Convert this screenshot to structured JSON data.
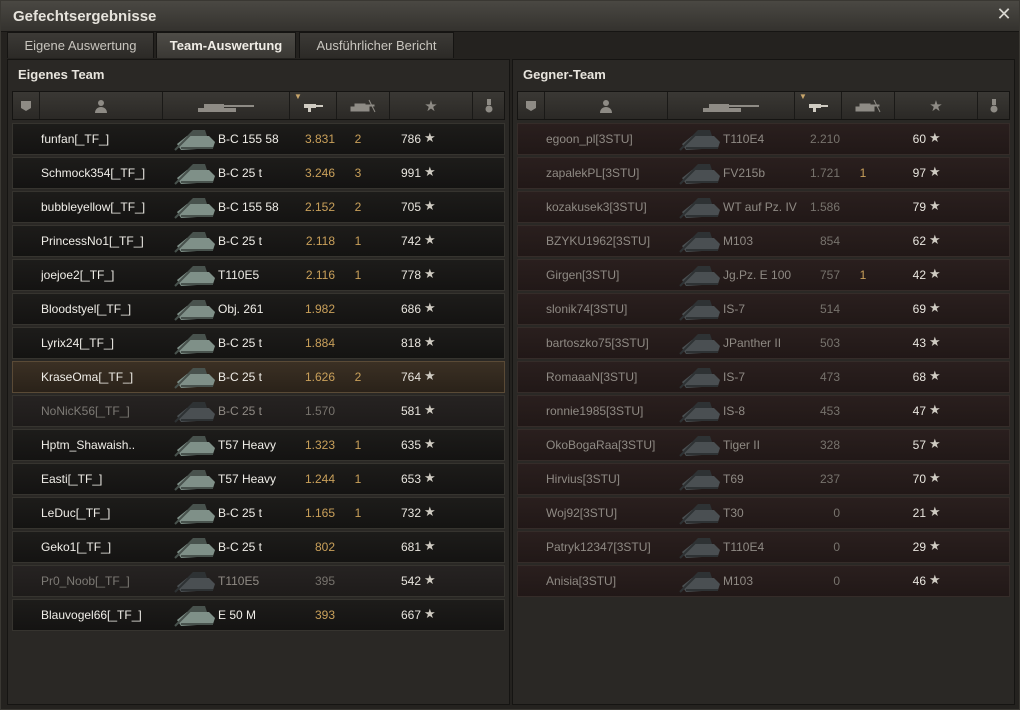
{
  "window": {
    "title": "Gefechtsergebnisse"
  },
  "tabs": [
    {
      "label": "Eigene Auswertung"
    },
    {
      "label": "Team-Auswertung"
    },
    {
      "label": "Ausführlicher Bericht"
    }
  ],
  "icons": {
    "close": "✕",
    "rank": "rank-icon",
    "player": "player-icon",
    "tank": "tank-icon",
    "damage": "damage-icon",
    "frags": "frags-icon",
    "star": "★",
    "medal": "medal-icon"
  },
  "colors": {
    "accent": "#c9a05a",
    "highlight_row": "#3b3024"
  },
  "own_team": {
    "title": "Eigenes Team",
    "rows": [
      {
        "name": "funfan[_TF_]",
        "tank": "B-C 155 58",
        "damage": "3.831",
        "kills": "2",
        "xp": "786",
        "state": "normal"
      },
      {
        "name": "Schmock354[_TF_]",
        "tank": "B-C 25 t",
        "damage": "3.246",
        "kills": "3",
        "xp": "991",
        "state": "normal"
      },
      {
        "name": "bubbleyellow[_TF_]",
        "tank": "B-C 155 58",
        "damage": "2.152",
        "kills": "2",
        "xp": "705",
        "state": "normal"
      },
      {
        "name": "PrincessNo1[_TF_]",
        "tank": "B-C 25 t",
        "damage": "2.118",
        "kills": "1",
        "xp": "742",
        "state": "normal"
      },
      {
        "name": "joejoe2[_TF_]",
        "tank": "T110E5",
        "damage": "2.116",
        "kills": "1",
        "xp": "778",
        "state": "normal"
      },
      {
        "name": "Bloodstyel[_TF_]",
        "tank": "Obj. 261",
        "damage": "1.982",
        "kills": "",
        "xp": "686",
        "state": "normal"
      },
      {
        "name": "Lyrix24[_TF_]",
        "tank": "B-C 25 t",
        "damage": "1.884",
        "kills": "",
        "xp": "818",
        "state": "normal"
      },
      {
        "name": "KraseOma[_TF_]",
        "tank": "B-C 25 t",
        "damage": "1.626",
        "kills": "2",
        "xp": "764",
        "state": "highlight"
      },
      {
        "name": "NoNicK56[_TF_]",
        "tank": "B-C 25 t",
        "damage": "1.570",
        "kills": "",
        "xp": "581",
        "state": "dead"
      },
      {
        "name": "Hptm_Shawaish..",
        "tank": "T57 Heavy",
        "damage": "1.323",
        "kills": "1",
        "xp": "635",
        "state": "normal"
      },
      {
        "name": "Easti[_TF_]",
        "tank": "T57 Heavy",
        "damage": "1.244",
        "kills": "1",
        "xp": "653",
        "state": "normal"
      },
      {
        "name": "LeDuc[_TF_]",
        "tank": "B-C 25 t",
        "damage": "1.165",
        "kills": "1",
        "xp": "732",
        "state": "normal"
      },
      {
        "name": "Geko1[_TF_]",
        "tank": "B-C 25 t",
        "damage": "802",
        "kills": "",
        "xp": "681",
        "state": "normal"
      },
      {
        "name": "Pr0_Noob[_TF_]",
        "tank": "T110E5",
        "damage": "395",
        "kills": "",
        "xp": "542",
        "state": "dead"
      },
      {
        "name": "Blauvogel66[_TF_]",
        "tank": "E 50 M",
        "damage": "393",
        "kills": "",
        "xp": "667",
        "state": "normal"
      }
    ]
  },
  "enemy_team": {
    "title": "Gegner-Team",
    "rows": [
      {
        "name": "egoon_pl[3STU]",
        "tank": "T110E4",
        "damage": "2.210",
        "kills": "",
        "xp": "60"
      },
      {
        "name": "zapalekPL[3STU]",
        "tank": "FV215b",
        "damage": "1.721",
        "kills": "1",
        "xp": "97"
      },
      {
        "name": "kozakusek3[3STU]",
        "tank": "WT auf Pz. IV",
        "damage": "1.586",
        "kills": "",
        "xp": "79"
      },
      {
        "name": "BZYKU1962[3STU]",
        "tank": "M103",
        "damage": "854",
        "kills": "",
        "xp": "62"
      },
      {
        "name": "Girgen[3STU]",
        "tank": "Jg.Pz. E 100",
        "damage": "757",
        "kills": "1",
        "xp": "42"
      },
      {
        "name": "slonik74[3STU]",
        "tank": "IS-7",
        "damage": "514",
        "kills": "",
        "xp": "69"
      },
      {
        "name": "bartoszko75[3STU]",
        "tank": "JPanther II",
        "damage": "503",
        "kills": "",
        "xp": "43"
      },
      {
        "name": "RomaaaN[3STU]",
        "tank": "IS-7",
        "damage": "473",
        "kills": "",
        "xp": "68"
      },
      {
        "name": "ronnie1985[3STU]",
        "tank": "IS-8",
        "damage": "453",
        "kills": "",
        "xp": "47"
      },
      {
        "name": "OkoBogaRaa[3STU]",
        "tank": "Tiger II",
        "damage": "328",
        "kills": "",
        "xp": "57"
      },
      {
        "name": "Hirvius[3STU]",
        "tank": "T69",
        "damage": "237",
        "kills": "",
        "xp": "70"
      },
      {
        "name": "Woj92[3STU]",
        "tank": "T30",
        "damage": "0",
        "kills": "",
        "xp": "21"
      },
      {
        "name": "Patryk12347[3STU]",
        "tank": "T110E4",
        "damage": "0",
        "kills": "",
        "xp": "29"
      },
      {
        "name": "Anisia[3STU]",
        "tank": "M103",
        "damage": "0",
        "kills": "",
        "xp": "46"
      }
    ]
  }
}
